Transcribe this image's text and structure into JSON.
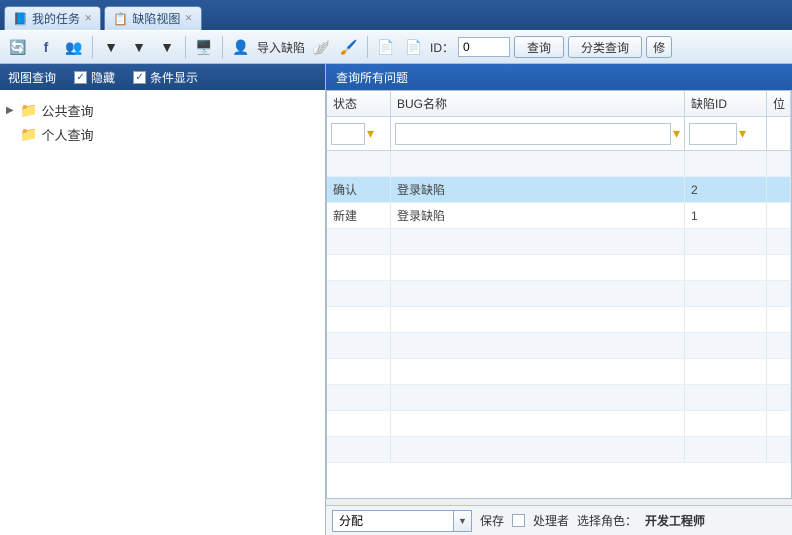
{
  "tabs": [
    {
      "label": "我的任务",
      "icon": "task-icon"
    },
    {
      "label": "缺陷视图",
      "icon": "bug-icon"
    }
  ],
  "toolbar": {
    "import_label": "导入缺陷",
    "id_label": "ID：",
    "id_value": "0",
    "query_btn": "查询",
    "category_query_btn": "分类查询",
    "edit_btn": "修"
  },
  "sidebar": {
    "title": "视图查询",
    "hide_label": "隐藏",
    "hide_checked": true,
    "cond_label": "条件显示",
    "cond_checked": true,
    "tree": [
      {
        "label": "公共查询",
        "expandable": true
      },
      {
        "label": "个人查询",
        "expandable": false
      }
    ]
  },
  "panel": {
    "title": "查询所有问题",
    "columns": {
      "status": "状态",
      "name": "BUG名称",
      "defect_id": "缺陷ID",
      "extra": "位"
    },
    "rows": [
      {
        "status": "确认",
        "name": "登录缺陷",
        "defect_id": "2",
        "selected": true
      },
      {
        "status": "新建",
        "name": "登录缺陷",
        "defect_id": "1",
        "selected": false
      }
    ]
  },
  "bottom": {
    "action_value": "分配",
    "save_label": "保存",
    "handler_label": "处理者",
    "role_label": "选择角色：",
    "role_value": "开发工程师"
  }
}
